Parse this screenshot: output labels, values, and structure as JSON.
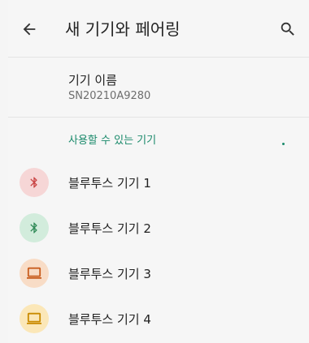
{
  "header": {
    "title": "새 기기와 페어링",
    "back_icon": "arrow-back-icon",
    "search_icon": "search-icon"
  },
  "device_name": {
    "label": "기기 이름",
    "value": "SN20210A9280"
  },
  "available_devices": {
    "header": "사용할 수 있는 기기",
    "accent_color": "#1a8a6b",
    "items": [
      {
        "label": "블루투스 기기 1",
        "icon": "bluetooth-icon",
        "icon_color": "#c94444",
        "bg_color": "#f6d6d6"
      },
      {
        "label": "블루투스 기기 2",
        "icon": "bluetooth-icon",
        "icon_color": "#2f8a57",
        "bg_color": "#d2ecdc"
      },
      {
        "label": "블루투스 기기 3",
        "icon": "laptop-icon",
        "icon_color": "#c85c1d",
        "bg_color": "#f8dcc6"
      },
      {
        "label": "블루투스 기기 4",
        "icon": "laptop-icon",
        "icon_color": "#c98a00",
        "bg_color": "#fbe7b8"
      }
    ]
  }
}
